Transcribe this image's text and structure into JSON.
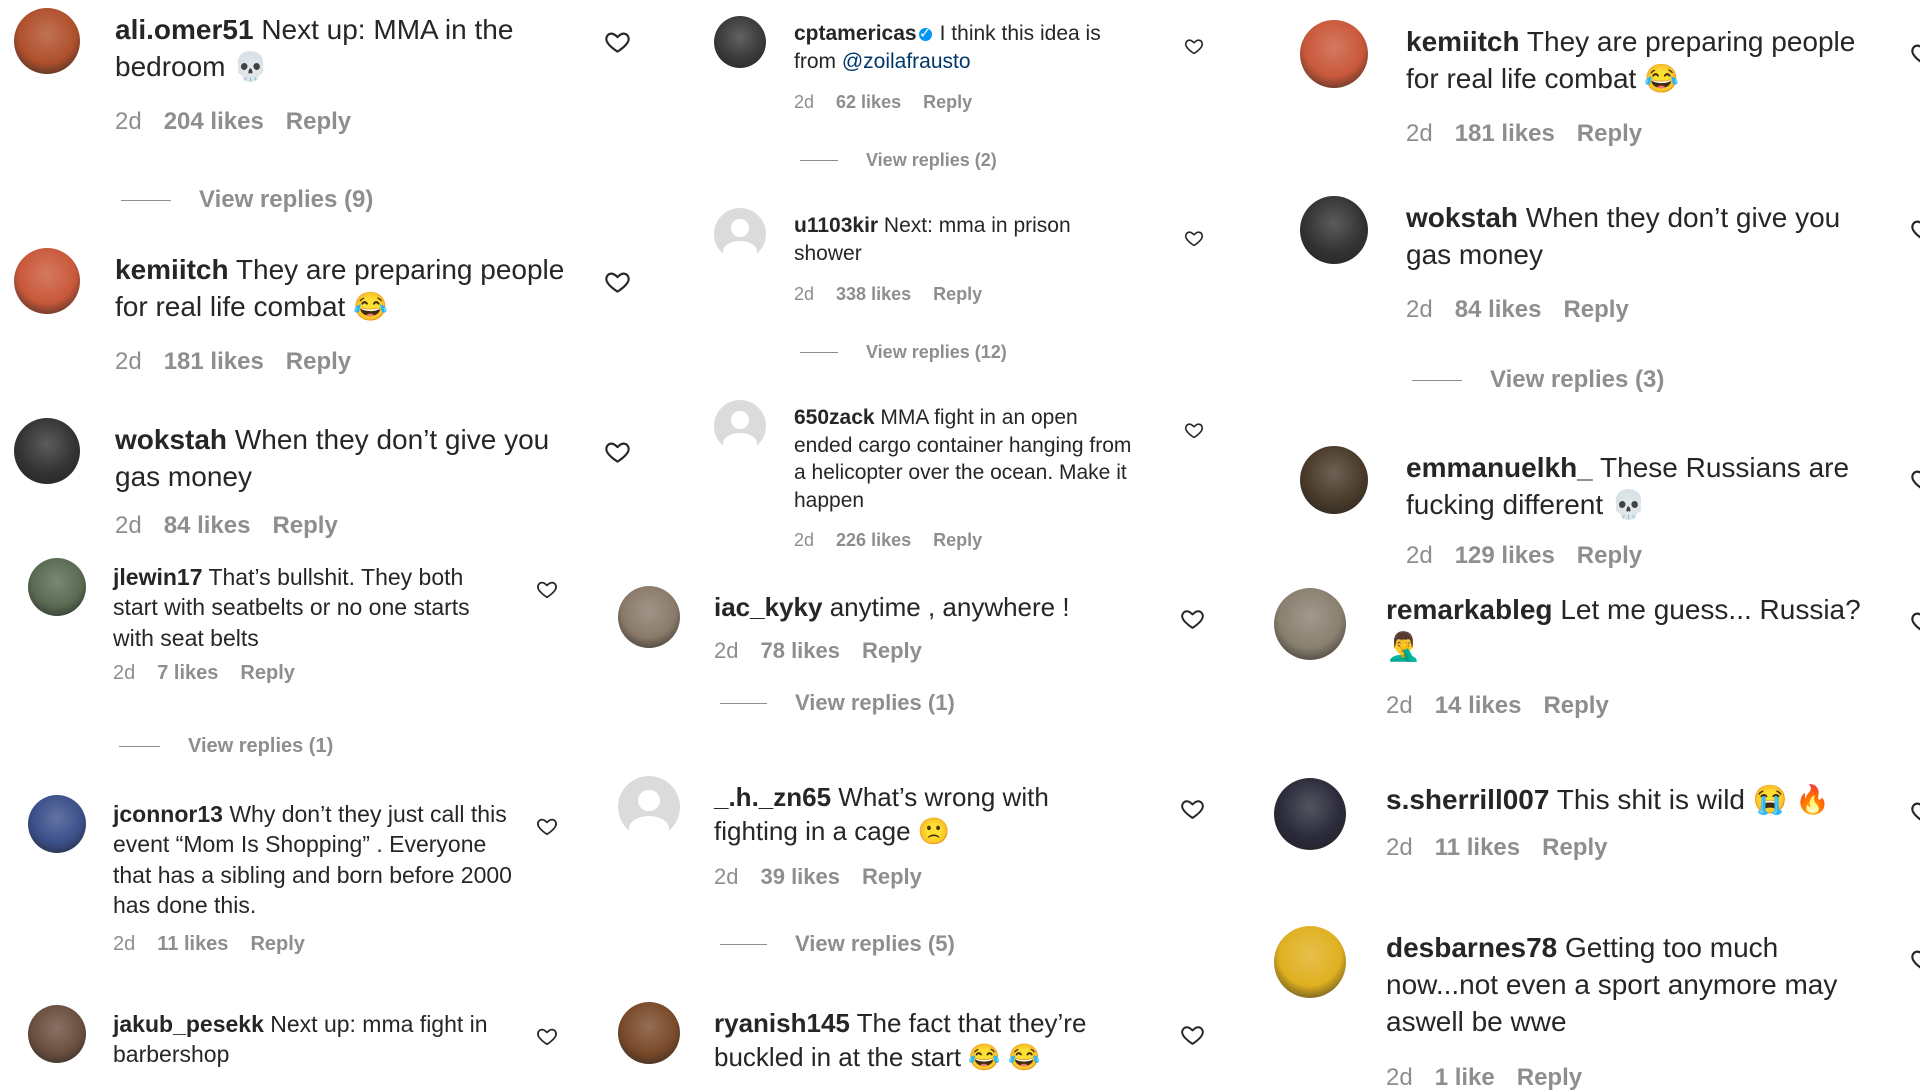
{
  "labels": {
    "reply": "Reply"
  },
  "colors": {
    "text": "#262626",
    "secondary": "#8e8e8e",
    "mention": "#00376b",
    "verified": "#0095f6"
  },
  "columns": [
    {
      "comments": [
        {
          "username": "ali.omer51",
          "text": "Next up: MMA in the bedroom",
          "emoji": "💀",
          "time": "2d",
          "likes": "204 likes",
          "view_replies": "View replies (9)"
        },
        {
          "username": "kemiitch",
          "text": "They are preparing people for real life combat",
          "emoji": "😂",
          "time": "2d",
          "likes": "181 likes"
        },
        {
          "username": "wokstah",
          "text": "When they don’t give you gas money",
          "time": "2d",
          "likes": "84 likes"
        },
        {
          "username": "jlewin17",
          "text": "That’s bullshit. They both start with seatbelts or no one starts with seat belts",
          "time": "2d",
          "likes": "7 likes",
          "view_replies": "View replies (1)"
        },
        {
          "username": "jconnor13",
          "text": "Why don’t they just call this event “Mom Is Shopping” . Everyone that has a sibling and born before 2000 has done this.",
          "time": "2d",
          "likes": "11 likes"
        },
        {
          "username": "jakub_pesekk",
          "text": "Next up: mma fight in barbershop"
        }
      ]
    },
    {
      "comments": [
        {
          "username": "cptamericas",
          "verified": true,
          "text": "I think this idea is from",
          "mention": "@zoilafrausto",
          "time": "2d",
          "likes": "62 likes",
          "view_replies": "View replies (2)"
        },
        {
          "username": "u1103kir",
          "text": "Next: mma in prison shower",
          "time": "2d",
          "likes": "338 likes",
          "view_replies": "View replies (12)"
        },
        {
          "username": "650zack",
          "text": "MMA fight in an open ended cargo container hanging from a helicopter over the ocean. Make it happen",
          "time": "2d",
          "likes": "226 likes"
        },
        {
          "username": "iac_kyky",
          "text": "anytime , anywhere !",
          "time": "2d",
          "likes": "78 likes",
          "view_replies": "View replies (1)"
        },
        {
          "username": "_.h._zn65",
          "text": "What’s wrong with fighting in a cage",
          "emoji": "🙁",
          "time": "2d",
          "likes": "39 likes",
          "view_replies": "View replies (5)"
        },
        {
          "username": "ryanish145",
          "text": "The fact that they’re buckled in at the start",
          "emoji": "😂 😂"
        }
      ]
    },
    {
      "comments": [
        {
          "username": "kemiitch",
          "text": "They are preparing people for real life combat",
          "emoji": "😂",
          "time": "2d",
          "likes": "181 likes"
        },
        {
          "username": "wokstah",
          "text": "When they don’t give you gas money",
          "time": "2d",
          "likes": "84 likes",
          "view_replies": "View replies (3)"
        },
        {
          "username": "emmanuelkh_",
          "text": "These Russians are fucking different",
          "emoji": "💀",
          "time": "2d",
          "likes": "129 likes"
        },
        {
          "username": "remarkableg",
          "text": "Let me guess... Russia?",
          "emoji": "🤦‍♂️",
          "time": "2d",
          "likes": "14 likes"
        },
        {
          "username": "s.sherrill007",
          "text": "This shit is wild",
          "emoji": "😭 🔥",
          "time": "2d",
          "likes": "11 likes"
        },
        {
          "username": "desbarnes78",
          "text": "Getting too much now...not even a sport anymore may aswell be wwe",
          "time": "2d",
          "likes": "1 like"
        }
      ]
    }
  ]
}
